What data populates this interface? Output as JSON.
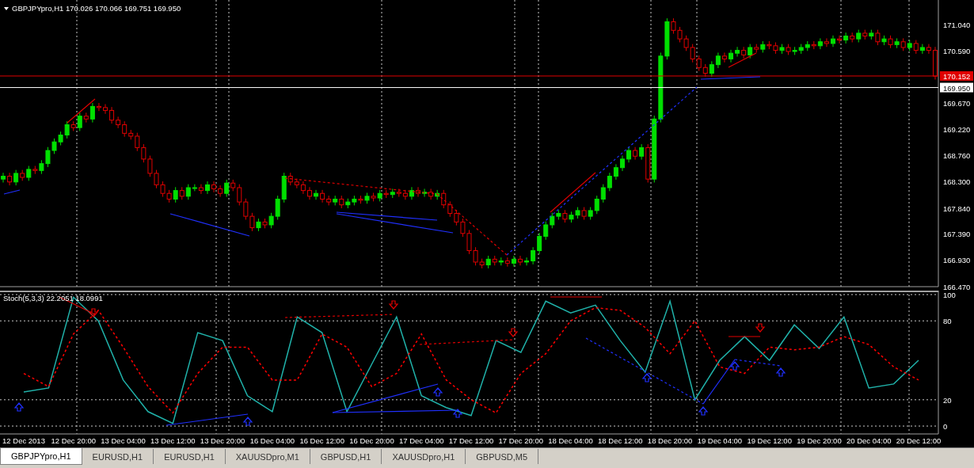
{
  "chart_header": {
    "text": "GBPJPYpro,H1  170.026 170.066 169.751 169.950"
  },
  "price_chart": {
    "chart_data": {
      "type": "candlestick",
      "ylim": [
        166.47,
        171.48
      ],
      "categories": [
        null,
        null,
        null,
        null,
        null,
        null,
        null,
        null,
        null,
        null,
        null,
        null,
        null,
        null,
        null,
        null,
        null,
        null,
        null,
        null,
        null,
        null,
        null,
        null,
        null,
        null,
        null,
        null,
        null,
        null,
        null,
        null,
        null,
        null,
        null,
        null,
        null,
        null,
        null,
        null,
        null,
        null,
        null,
        null,
        null,
        null,
        null,
        null,
        null,
        null,
        null,
        null,
        null,
        null,
        null,
        null,
        null,
        null,
        null,
        null,
        null,
        null,
        null,
        null,
        null,
        null,
        null,
        null,
        null,
        null,
        null,
        null,
        null,
        null,
        null,
        null,
        null,
        null,
        null,
        null,
        null,
        null,
        null,
        null,
        null,
        null,
        null,
        null,
        null,
        null,
        null,
        null,
        null,
        null,
        null,
        null,
        null,
        null,
        null,
        null,
        null,
        null,
        null,
        null,
        null,
        null,
        null,
        null,
        null,
        null,
        null,
        null,
        null,
        null,
        null,
        null,
        null,
        null,
        null,
        null,
        null,
        null,
        null,
        null,
        null,
        null,
        null,
        null,
        null,
        null,
        null,
        null,
        null,
        null,
        null,
        null,
        null,
        null,
        null,
        null,
        null,
        null,
        null,
        null,
        null,
        null,
        null
      ],
      "yticks": [
        {
          "value": 171.04,
          "label": "171.040"
        },
        {
          "value": 170.59,
          "label": "170.590"
        },
        {
          "value": 169.67,
          "label": "169.670"
        },
        {
          "value": 169.22,
          "label": "169.220"
        },
        {
          "value": 168.76,
          "label": "168.760"
        },
        {
          "value": 168.3,
          "label": "168.300"
        },
        {
          "value": 167.84,
          "label": "167.840"
        },
        {
          "value": 167.39,
          "label": "167.390"
        },
        {
          "value": 166.93,
          "label": "166.930"
        },
        {
          "value": 166.47,
          "label": "166.470"
        }
      ],
      "ref_lines": [
        {
          "axis": "y",
          "value": 170.152,
          "label": "170.152",
          "color": "#e00000"
        },
        {
          "axis": "y",
          "value": 169.95,
          "label": "169.950",
          "color": "#ffffff"
        }
      ],
      "ohlc": [
        [
          168.35,
          168.46,
          168.29,
          168.4
        ],
        [
          168.4,
          168.46,
          168.24,
          168.3
        ],
        [
          168.3,
          168.51,
          168.24,
          168.45
        ],
        [
          168.45,
          168.51,
          168.32,
          168.38
        ],
        [
          168.38,
          168.58,
          168.32,
          168.52
        ],
        [
          168.52,
          168.58,
          168.44,
          168.5
        ],
        [
          168.5,
          168.68,
          168.44,
          168.62
        ],
        [
          168.62,
          168.91,
          168.56,
          168.85
        ],
        [
          168.85,
          169.06,
          168.79,
          169.0
        ],
        [
          169.0,
          169.18,
          168.94,
          169.12
        ],
        [
          169.12,
          169.36,
          169.06,
          169.3
        ],
        [
          169.3,
          169.36,
          169.19,
          169.25
        ],
        [
          169.25,
          169.51,
          169.19,
          169.45
        ],
        [
          169.45,
          169.51,
          169.34,
          169.4
        ],
        [
          169.4,
          169.68,
          169.34,
          169.62
        ],
        [
          169.62,
          169.68,
          169.54,
          169.6
        ],
        [
          169.6,
          169.66,
          169.49,
          169.55
        ],
        [
          169.55,
          169.61,
          169.32,
          169.38
        ],
        [
          169.38,
          169.44,
          169.24,
          169.3
        ],
        [
          169.3,
          169.36,
          169.09,
          169.15
        ],
        [
          169.15,
          169.21,
          169.04,
          169.1
        ],
        [
          169.1,
          169.16,
          168.84,
          168.9
        ],
        [
          168.9,
          168.96,
          168.64,
          168.7
        ],
        [
          168.7,
          168.76,
          168.39,
          168.45
        ],
        [
          168.45,
          168.51,
          168.19,
          168.25
        ],
        [
          168.25,
          168.31,
          168.04,
          168.1
        ],
        [
          168.1,
          168.16,
          167.94,
          168.0
        ],
        [
          168.0,
          168.21,
          167.94,
          168.15
        ],
        [
          168.15,
          168.21,
          167.99,
          168.05
        ],
        [
          168.05,
          168.26,
          167.99,
          168.2
        ],
        [
          168.2,
          168.26,
          168.14,
          168.2
        ],
        [
          168.2,
          168.26,
          168.09,
          168.15
        ],
        [
          168.15,
          168.31,
          168.09,
          168.25
        ],
        [
          168.25,
          168.31,
          168.12,
          168.18
        ],
        [
          168.18,
          168.24,
          168.04,
          168.1
        ],
        [
          168.1,
          168.34,
          168.04,
          168.28
        ],
        [
          168.28,
          168.34,
          168.14,
          168.2
        ],
        [
          168.2,
          168.26,
          167.89,
          167.95
        ],
        [
          167.95,
          168.01,
          167.64,
          167.7
        ],
        [
          167.7,
          167.76,
          167.44,
          167.5
        ],
        [
          167.5,
          167.66,
          167.44,
          167.6
        ],
        [
          167.6,
          167.66,
          167.49,
          167.55
        ],
        [
          167.55,
          167.76,
          167.49,
          167.7
        ],
        [
          167.7,
          168.06,
          167.64,
          168.0
        ],
        [
          168.0,
          168.46,
          167.94,
          168.4
        ],
        [
          168.4,
          168.46,
          168.24,
          168.3
        ],
        [
          168.3,
          168.36,
          168.19,
          168.25
        ],
        [
          168.25,
          168.31,
          168.09,
          168.15
        ],
        [
          168.15,
          168.21,
          167.99,
          168.05
        ],
        [
          168.05,
          168.16,
          167.99,
          168.1
        ],
        [
          168.1,
          168.16,
          167.94,
          168.0
        ],
        [
          168.0,
          168.06,
          167.89,
          167.95
        ],
        [
          167.95,
          168.06,
          167.89,
          168.0
        ],
        [
          168.0,
          168.06,
          167.84,
          167.9
        ],
        [
          167.9,
          168.01,
          167.84,
          167.95
        ],
        [
          167.95,
          168.06,
          167.89,
          168.0
        ],
        [
          168.0,
          168.06,
          167.92,
          167.98
        ],
        [
          167.98,
          168.11,
          167.92,
          168.05
        ],
        [
          168.05,
          168.11,
          167.96,
          168.02
        ],
        [
          168.02,
          168.16,
          167.96,
          168.1
        ],
        [
          168.1,
          168.16,
          168.02,
          168.08
        ],
        [
          168.08,
          168.18,
          168.02,
          168.12
        ],
        [
          168.12,
          168.18,
          168.04,
          168.1
        ],
        [
          168.1,
          168.16,
          167.99,
          168.05
        ],
        [
          168.05,
          168.21,
          167.99,
          168.15
        ],
        [
          168.15,
          168.21,
          168.04,
          168.1
        ],
        [
          168.1,
          168.18,
          168.04,
          168.12
        ],
        [
          168.12,
          168.18,
          167.99,
          168.05
        ],
        [
          168.05,
          168.16,
          167.99,
          168.1
        ],
        [
          168.1,
          168.16,
          167.84,
          167.9
        ],
        [
          167.9,
          167.96,
          167.69,
          167.75
        ],
        [
          167.75,
          167.81,
          167.54,
          167.6
        ],
        [
          167.6,
          167.66,
          167.34,
          167.4
        ],
        [
          167.4,
          167.46,
          167.04,
          167.1
        ],
        [
          167.1,
          167.16,
          166.84,
          166.9
        ],
        [
          166.9,
          166.96,
          166.79,
          166.85
        ],
        [
          166.85,
          167.01,
          166.79,
          166.95
        ],
        [
          166.95,
          167.01,
          166.84,
          166.9
        ],
        [
          166.9,
          166.98,
          166.84,
          166.92
        ],
        [
          166.92,
          166.98,
          166.82,
          166.88
        ],
        [
          166.88,
          167.01,
          166.82,
          166.95
        ],
        [
          166.95,
          167.01,
          166.84,
          166.9
        ],
        [
          166.9,
          166.98,
          166.84,
          166.92
        ],
        [
          166.92,
          167.16,
          166.86,
          167.1
        ],
        [
          167.1,
          167.41,
          167.04,
          167.35
        ],
        [
          167.35,
          167.61,
          167.29,
          167.55
        ],
        [
          167.55,
          167.76,
          167.49,
          167.7
        ],
        [
          167.7,
          167.81,
          167.64,
          167.75
        ],
        [
          167.75,
          167.81,
          167.59,
          167.65
        ],
        [
          167.65,
          167.78,
          167.59,
          167.72
        ],
        [
          167.72,
          167.86,
          167.66,
          167.8
        ],
        [
          167.8,
          167.86,
          167.64,
          167.7
        ],
        [
          167.7,
          167.86,
          167.64,
          167.8
        ],
        [
          167.8,
          168.06,
          167.74,
          168.0
        ],
        [
          168.0,
          168.26,
          167.94,
          168.2
        ],
        [
          168.2,
          168.46,
          168.14,
          168.4
        ],
        [
          168.4,
          168.61,
          168.34,
          168.55
        ],
        [
          168.55,
          168.76,
          168.49,
          168.7
        ],
        [
          168.7,
          168.91,
          168.64,
          168.85
        ],
        [
          168.85,
          168.91,
          168.69,
          168.75
        ],
        [
          168.75,
          168.96,
          168.69,
          168.9
        ],
        [
          168.9,
          168.96,
          168.29,
          168.35
        ],
        [
          168.35,
          169.46,
          168.29,
          169.4
        ],
        [
          169.4,
          170.56,
          169.34,
          170.5
        ],
        [
          170.5,
          171.16,
          170.44,
          171.1
        ],
        [
          171.1,
          171.16,
          170.89,
          170.95
        ],
        [
          170.95,
          171.01,
          170.74,
          170.8
        ],
        [
          170.8,
          170.86,
          170.59,
          170.65
        ],
        [
          170.65,
          170.71,
          170.39,
          170.45
        ],
        [
          170.45,
          170.51,
          170.24,
          170.3
        ],
        [
          170.3,
          170.36,
          170.14,
          170.2
        ],
        [
          170.2,
          170.41,
          170.14,
          170.35
        ],
        [
          170.35,
          170.56,
          170.29,
          170.5
        ],
        [
          170.5,
          170.56,
          170.39,
          170.45
        ],
        [
          170.45,
          170.61,
          170.39,
          170.55
        ],
        [
          170.55,
          170.66,
          170.49,
          170.6
        ],
        [
          170.6,
          170.66,
          170.46,
          170.52
        ],
        [
          170.52,
          170.71,
          170.46,
          170.65
        ],
        [
          170.65,
          170.71,
          170.56,
          170.62
        ],
        [
          170.62,
          170.76,
          170.56,
          170.7
        ],
        [
          170.7,
          170.76,
          170.62,
          170.68
        ],
        [
          170.68,
          170.74,
          170.54,
          170.6
        ],
        [
          170.6,
          170.71,
          170.54,
          170.65
        ],
        [
          170.65,
          170.71,
          170.52,
          170.58
        ],
        [
          170.58,
          170.66,
          170.52,
          170.6
        ],
        [
          170.6,
          170.71,
          170.54,
          170.65
        ],
        [
          170.65,
          170.76,
          170.59,
          170.7
        ],
        [
          170.7,
          170.76,
          170.62,
          170.68
        ],
        [
          170.68,
          170.81,
          170.62,
          170.75
        ],
        [
          170.75,
          170.81,
          170.66,
          170.72
        ],
        [
          170.72,
          170.86,
          170.66,
          170.8
        ],
        [
          170.8,
          170.86,
          170.72,
          170.78
        ],
        [
          170.78,
          170.91,
          170.72,
          170.85
        ],
        [
          170.85,
          170.91,
          170.74,
          170.8
        ],
        [
          170.8,
          170.96,
          170.74,
          170.9
        ],
        [
          170.9,
          170.96,
          170.79,
          170.85
        ],
        [
          170.85,
          170.96,
          170.79,
          170.9
        ],
        [
          170.9,
          170.96,
          170.69,
          170.75
        ],
        [
          170.75,
          170.86,
          170.69,
          170.8
        ],
        [
          170.8,
          170.86,
          170.64,
          170.7
        ],
        [
          170.7,
          170.81,
          170.64,
          170.75
        ],
        [
          170.75,
          170.81,
          170.59,
          170.65
        ],
        [
          170.65,
          170.78,
          170.59,
          170.72
        ],
        [
          170.72,
          170.78,
          170.54,
          170.6
        ],
        [
          170.6,
          170.71,
          170.54,
          170.65
        ],
        [
          170.65,
          170.71,
          170.54,
          170.6
        ],
        [
          170.6,
          170.66,
          170.09,
          170.15
        ]
      ]
    }
  },
  "indicator": {
    "label": "Stoch(5,3,3) 22.2051 18.0991",
    "chart_data": {
      "type": "line",
      "ylim": [
        -6,
        103
      ],
      "yticks": [
        0,
        20,
        80,
        100
      ],
      "grid": true,
      "categories": [
        "12 Dec 2013",
        null,
        "12 Dec 20:00",
        null,
        "13 Dec 04:00",
        null,
        "13 Dec 12:00",
        null,
        "13 Dec 20:00",
        null,
        "16 Dec 04:00",
        null,
        "16 Dec 12:00",
        null,
        "16 Dec 20:00",
        null,
        "17 Dec 04:00",
        null,
        "17 Dec 12:00",
        null,
        "17 Dec 20:00",
        null,
        "18 Dec 04:00",
        null,
        "18 Dec 12:00",
        null,
        "18 Dec 20:00",
        null,
        "19 Dec 04:00",
        null,
        "19 Dec 12:00",
        null,
        "19 Dec 20:00",
        null,
        "20 Dec 04:00",
        null,
        "20 Dec 12:00"
      ],
      "series": [
        {
          "color": "#20b2aa",
          "line_style": "solid",
          "values": [
            26,
            29,
            98,
            80,
            35,
            11,
            2,
            71,
            65,
            23,
            11,
            83,
            71,
            11,
            47,
            83,
            23,
            14,
            8,
            65,
            56,
            95,
            86,
            92,
            65,
            41,
            95,
            20,
            50,
            68,
            50,
            77,
            59,
            83,
            29,
            32,
            50
          ]
        },
        {
          "color": "#ff0000",
          "line_style": "dashed",
          "values": [
            40,
            30,
            70,
            88,
            60,
            30,
            10,
            40,
            60,
            60,
            35,
            35,
            70,
            60,
            30,
            40,
            70,
            35,
            20,
            10,
            40,
            55,
            80,
            90,
            88,
            75,
            55,
            80,
            45,
            40,
            60,
            58,
            60,
            68,
            62,
            45,
            35
          ]
        }
      ]
    }
  },
  "tabs": [
    {
      "label": "GBPJPYpro,H1",
      "selected": true
    },
    {
      "label": "EURUSD,H1",
      "selected": false
    },
    {
      "label": "EURUSD,H1",
      "selected": false
    },
    {
      "label": "XAUUSDpro,M1",
      "selected": false
    },
    {
      "label": "GBPUSD,H1",
      "selected": false
    },
    {
      "label": "XAUUSDpro,H1",
      "selected": false
    },
    {
      "label": "GBPUSD,M5",
      "selected": false
    }
  ]
}
